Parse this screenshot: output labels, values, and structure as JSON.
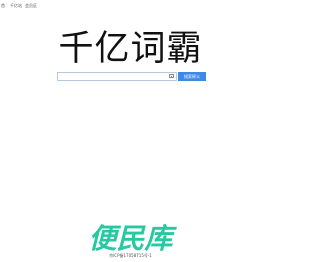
{
  "topnav": {
    "items": [
      "首",
      "千亿站",
      "会员区"
    ]
  },
  "logo": {
    "text": "千亿词霸"
  },
  "search": {
    "value": "",
    "placeholder": "",
    "button_label": "搜索释义"
  },
  "footer": {
    "brand": "便民库",
    "icp": "京ICP备17058715号-1"
  }
}
